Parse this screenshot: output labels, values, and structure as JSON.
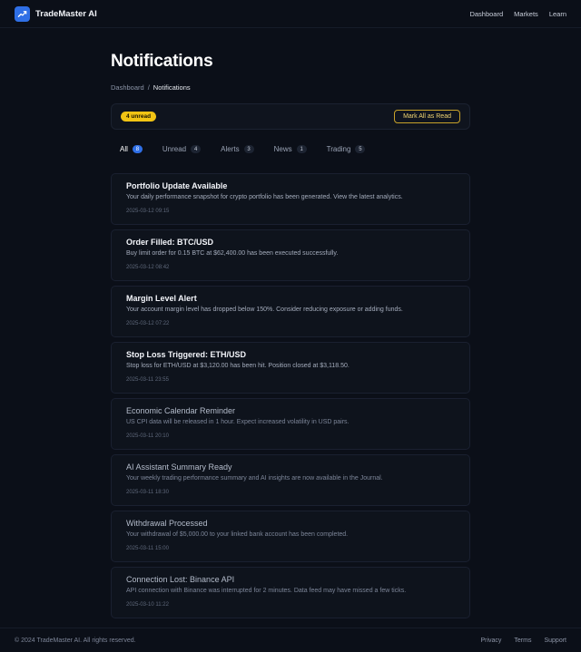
{
  "brand": {
    "name": "TradeMaster AI",
    "logo_icon": "trend-chart-icon",
    "accent": "#2f6fe6"
  },
  "nav": {
    "items": [
      "Dashboard",
      "Markets",
      "Learn"
    ]
  },
  "page": {
    "title": "Notifications",
    "breadcrumb": {
      "root": "Dashboard",
      "separator": "/",
      "current": "Notifications"
    }
  },
  "actions": {
    "unread_badge": "4 unread",
    "mark_all_label": "Mark All as Read"
  },
  "tabs": [
    {
      "label": "All",
      "count": "8",
      "active": true
    },
    {
      "label": "Unread",
      "count": "4"
    },
    {
      "label": "Alerts",
      "count": "3"
    },
    {
      "label": "News",
      "count": "1"
    },
    {
      "label": "Trading",
      "count": "5"
    }
  ],
  "notifications": [
    {
      "title": "Portfolio Update Available",
      "body": "Your daily performance snapshot for crypto portfolio has been generated. View the latest analytics.",
      "time": "2025-03-12 09:15",
      "unread": true
    },
    {
      "title": "Order Filled: BTC/USD",
      "body": "Buy limit order for 0.15 BTC at $62,400.00 has been executed successfully.",
      "time": "2025-03-12 08:42",
      "unread": true
    },
    {
      "title": "Margin Level Alert",
      "body": "Your account margin level has dropped below 150%. Consider reducing exposure or adding funds.",
      "time": "2025-03-12 07:22",
      "unread": true
    },
    {
      "title": "Stop Loss Triggered: ETH/USD",
      "body": "Stop loss for ETH/USD at $3,120.00 has been hit. Position closed at $3,118.50.",
      "time": "2025-03-11 23:55",
      "unread": true
    },
    {
      "title": "Economic Calendar Reminder",
      "body": "US CPI data will be released in 1 hour. Expect increased volatility in USD pairs.",
      "time": "2025-03-11 20:10",
      "unread": false
    },
    {
      "title": "AI Assistant Summary Ready",
      "body": "Your weekly trading performance summary and AI insights are now available in the Journal.",
      "time": "2025-03-11 18:30",
      "unread": false
    },
    {
      "title": "Withdrawal Processed",
      "body": "Your withdrawal of $5,000.00 to your linked bank account has been completed.",
      "time": "2025-03-11 15:00",
      "unread": false
    },
    {
      "title": "Connection Lost: Binance API",
      "body": "API connection with Binance was interrupted for 2 minutes. Data feed may have missed a few ticks.",
      "time": "2025-03-10 11:22",
      "unread": false
    }
  ],
  "footer": {
    "copyright": "© 2024 TradeMaster AI. All rights reserved.",
    "links": [
      "Privacy",
      "Terms",
      "Support"
    ]
  }
}
